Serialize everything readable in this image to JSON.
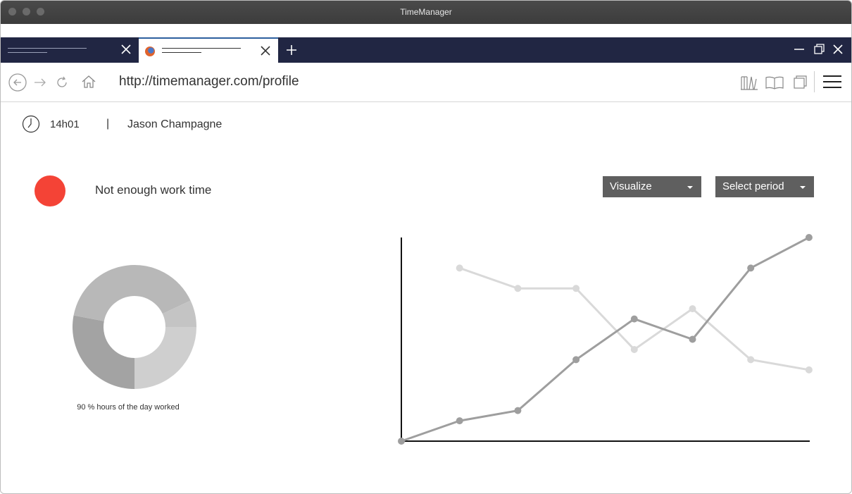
{
  "window": {
    "title": "TimeManager"
  },
  "browser": {
    "url": "http://timemanager.com/profile",
    "tabs": [
      {
        "active": false
      },
      {
        "active": true
      }
    ]
  },
  "header": {
    "time": "14h01",
    "separator": "|",
    "user_name": "Jason Champagne"
  },
  "status": {
    "color": "#f44336",
    "text": "Not enough work time"
  },
  "controls": {
    "visualize_label": "Visualize",
    "period_label": "Select period"
  },
  "donut": {
    "caption": "90 % hours of the day worked",
    "slices": [
      {
        "value": 25,
        "color": "#cfcfcf"
      },
      {
        "value": 28,
        "color": "#a3a3a3"
      },
      {
        "value": 40,
        "color": "#b8b8b8"
      },
      {
        "value": 7,
        "color": "#c4c4c4"
      }
    ]
  },
  "chart_data": {
    "type": "line",
    "x": [
      0,
      1,
      2,
      3,
      4,
      5,
      6,
      7
    ],
    "ylim": [
      0,
      10
    ],
    "series": [
      {
        "color": "#9e9e9e",
        "values": [
          0,
          1,
          1.5,
          4,
          6,
          5,
          8.5,
          10
        ],
        "x": [
          0,
          1,
          2,
          3,
          4,
          5,
          6,
          7
        ]
      },
      {
        "color": "#d9d9d9",
        "values": [
          8.5,
          7.5,
          7.5,
          4.5,
          6.5,
          4,
          3.5
        ],
        "x": [
          1,
          2,
          3,
          4,
          5,
          6,
          7
        ]
      }
    ]
  }
}
